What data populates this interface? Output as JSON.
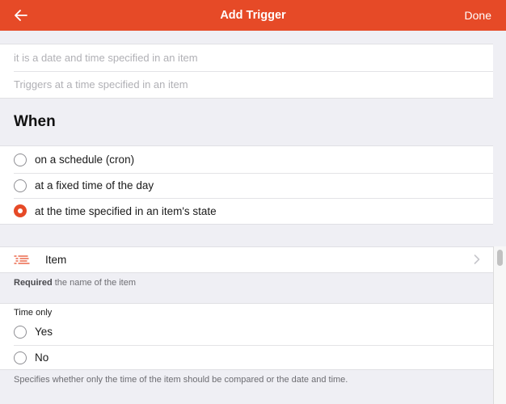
{
  "navbar": {
    "back_icon": "arrow-left-icon",
    "title": "Add Trigger",
    "done_label": "Done",
    "accent_color": "#e64a27"
  },
  "fields": {
    "label_placeholder": "it is a date and time specified in an item",
    "description_placeholder": "Triggers at a time specified in an item"
  },
  "when": {
    "header": "When",
    "options": [
      {
        "label": "on a schedule (cron)",
        "checked": false
      },
      {
        "label": "at a fixed time of the day",
        "checked": false
      },
      {
        "label": "at the time specified in an item's state",
        "checked": true
      }
    ]
  },
  "item": {
    "icon": "list-icon",
    "label": "Item",
    "chevron_icon": "chevron-right-icon",
    "help_required": "Required",
    "help_text": " the name of the item"
  },
  "time_only": {
    "label": "Time only",
    "options": [
      {
        "label": "Yes",
        "checked": false
      },
      {
        "label": "No",
        "checked": false
      }
    ],
    "help_text": "Specifies whether only the time of the item should be compared or the date and time."
  }
}
